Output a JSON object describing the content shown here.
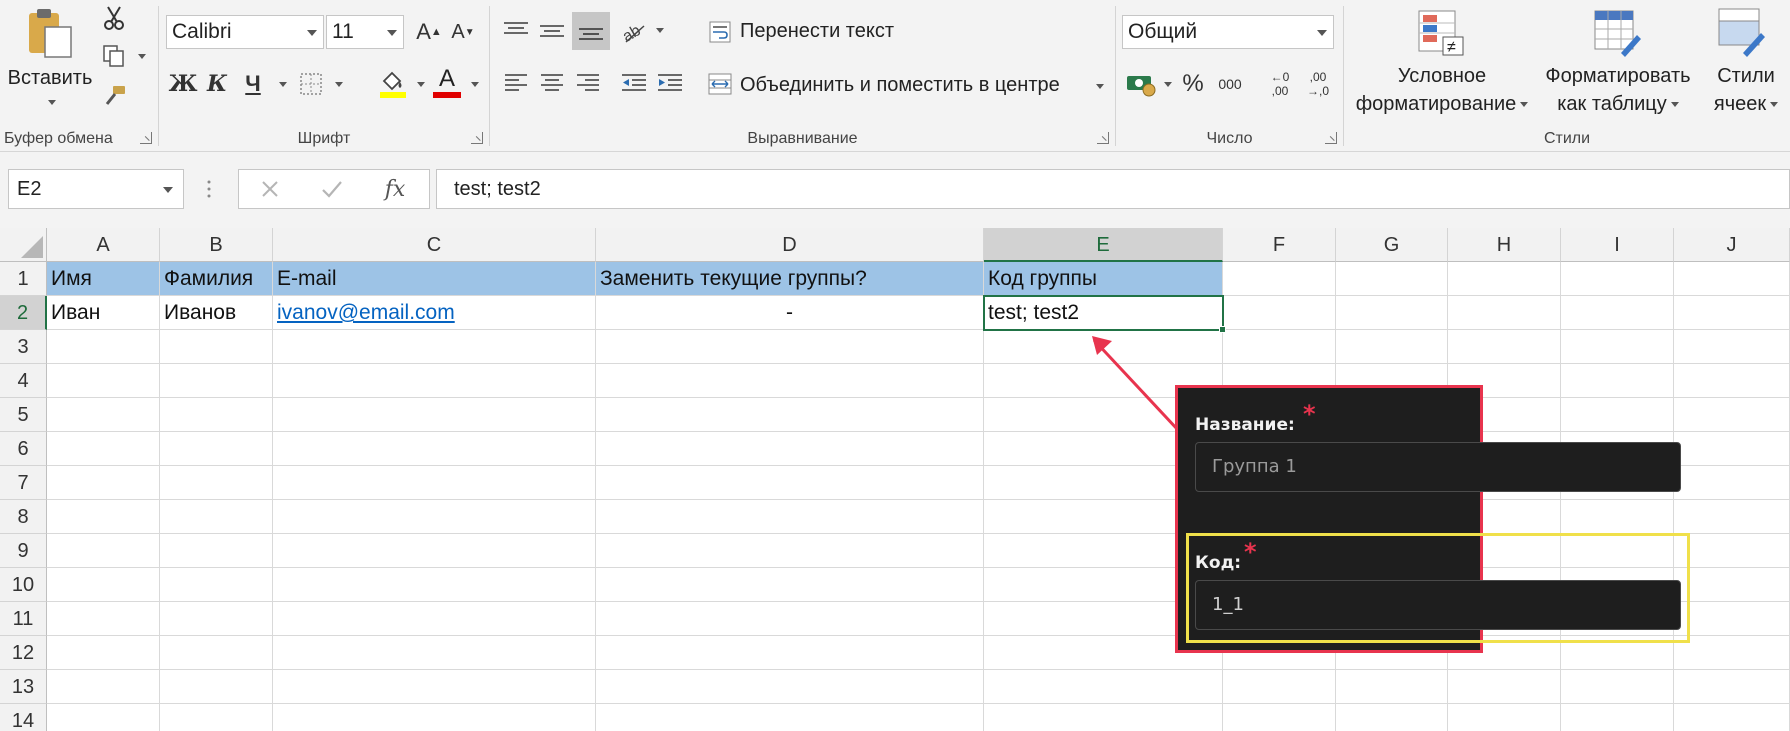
{
  "ribbon": {
    "clipboard": {
      "label": "Буфер обмена",
      "paste": "Вставить"
    },
    "font": {
      "label": "Шрифт",
      "name": "Calibri",
      "size": "11",
      "bold": "Ж",
      "italic": "К",
      "underline": "Ч",
      "color_letter": "A",
      "grow": "A",
      "shrink": "A"
    },
    "alignment": {
      "label": "Выравнивание",
      "wrap": "Перенести текст",
      "merge": "Объединить и поместить в центре"
    },
    "number": {
      "label": "Число",
      "format": "Общий",
      "percent": "%",
      "thousands": "000",
      "inc_dec_top": "←0",
      "inc_dec_bot": ",00",
      "dec_dec_top": ",00",
      "dec_dec_bot": "→,0"
    },
    "styles": {
      "label": "Стили",
      "conditional": [
        "Условное",
        "форматирование"
      ],
      "as_table": [
        "Форматировать",
        "как таблицу"
      ],
      "cell_styles": [
        "Стили",
        "ячеек"
      ]
    }
  },
  "formula_bar": {
    "name_box": "E2",
    "fx": "fx",
    "content": "test; test2"
  },
  "grid": {
    "columns": [
      "A",
      "B",
      "C",
      "D",
      "E",
      "F",
      "G",
      "H",
      "I",
      "J"
    ],
    "rows": [
      "1",
      "2",
      "3",
      "4",
      "5",
      "6",
      "7",
      "8",
      "9",
      "10",
      "11",
      "12",
      "13",
      "14"
    ],
    "row1": [
      "Имя",
      "Фамилия",
      "E-mail",
      "Заменить текущие группы?",
      "Код группы"
    ],
    "row2": [
      "Иван",
      "Иванов",
      "ivanov@email.com",
      "-",
      "test; test2"
    ]
  },
  "panel": {
    "name_label": "Название:",
    "name_value": "Группа 1",
    "code_label": "Код:",
    "code_value": "1_1",
    "required_mark": "*"
  },
  "colors": {
    "header_fill": "#9dc3e6",
    "selection": "#217346",
    "highlight_red": "#e8344e",
    "highlight_yellow": "#f0e04a",
    "link": "#0563c1"
  }
}
